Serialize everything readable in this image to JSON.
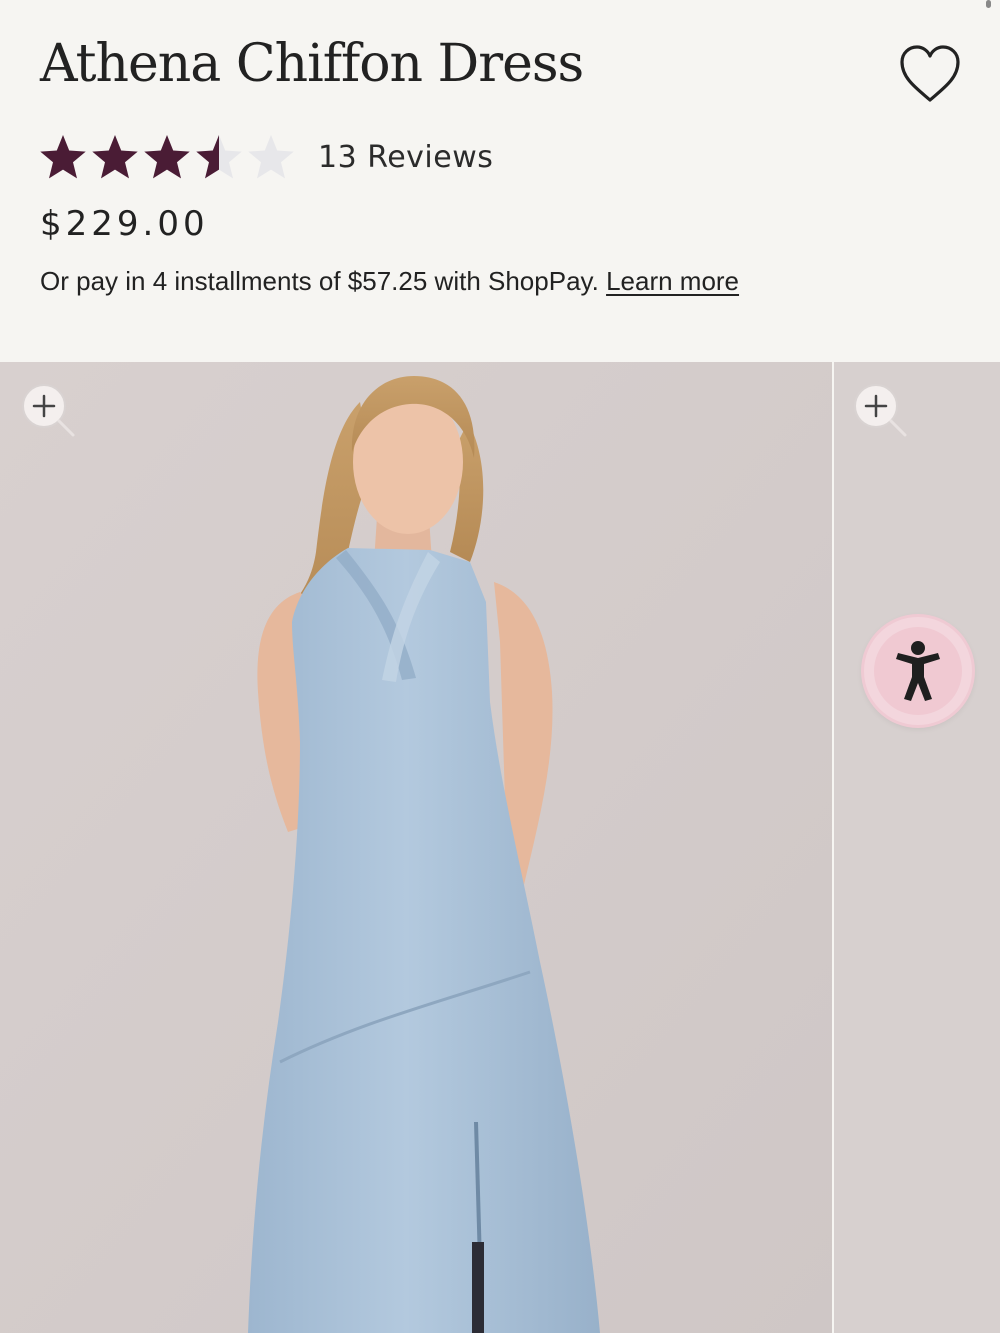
{
  "product": {
    "title": "Athena Chiffon Dress",
    "rating": 3.5,
    "rating_max": 5,
    "reviews_label": "13 Reviews",
    "price": "$229.00",
    "installments_text": "Or pay in 4 installments of $57.25 with ShopPay.",
    "learn_more_label": "Learn more"
  },
  "colors": {
    "star_filled": "#4a1c35",
    "star_empty": "#e7e7ea",
    "background": "#f6f5f2",
    "dress": "#a9c2db",
    "accessibility_button": "#f3d6dd"
  },
  "icons": {
    "wishlist": "heart-outline-icon",
    "zoom": "zoom-in-icon",
    "accessibility": "accessibility-person-icon"
  },
  "gallery": {
    "main_image": "Model wearing light blue halter chiffon maxi dress",
    "slides_visible": 2
  }
}
